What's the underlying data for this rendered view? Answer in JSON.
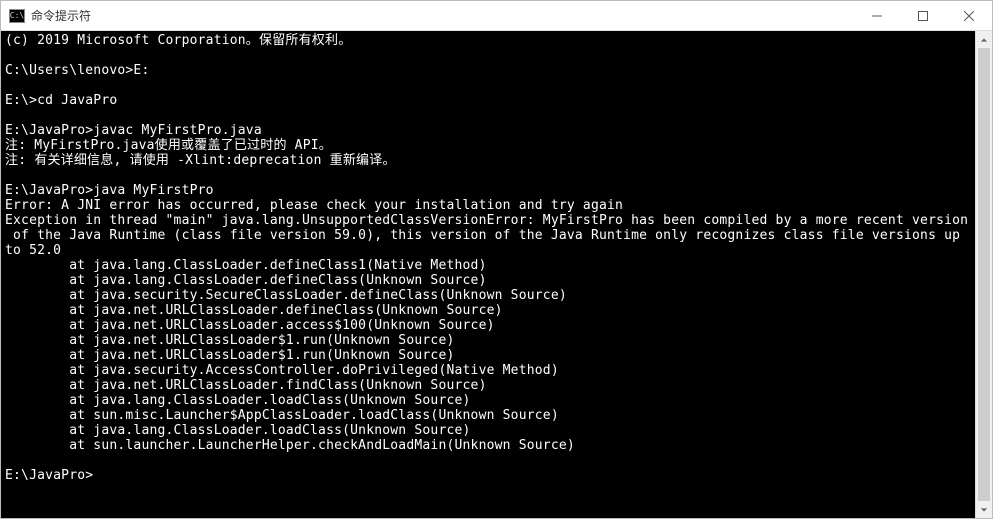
{
  "window": {
    "title": "命令提示符",
    "icon_text": "C:\\"
  },
  "terminal": {
    "lines": [
      "(c) 2019 Microsoft Corporation。保留所有权利。",
      "",
      "C:\\Users\\lenovo>E:",
      "",
      "E:\\>cd JavaPro",
      "",
      "E:\\JavaPro>javac MyFirstPro.java",
      "注: MyFirstPro.java使用或覆盖了已过时的 API。",
      "注: 有关详细信息, 请使用 -Xlint:deprecation 重新编译。",
      "",
      "E:\\JavaPro>java MyFirstPro",
      "Error: A JNI error has occurred, please check your installation and try again",
      "Exception in thread \"main\" java.lang.UnsupportedClassVersionError: MyFirstPro has been compiled by a more recent version",
      " of the Java Runtime (class file version 59.0), this version of the Java Runtime only recognizes class file versions up",
      "to 52.0",
      "        at java.lang.ClassLoader.defineClass1(Native Method)",
      "        at java.lang.ClassLoader.defineClass(Unknown Source)",
      "        at java.security.SecureClassLoader.defineClass(Unknown Source)",
      "        at java.net.URLClassLoader.defineClass(Unknown Source)",
      "        at java.net.URLClassLoader.access$100(Unknown Source)",
      "        at java.net.URLClassLoader$1.run(Unknown Source)",
      "        at java.net.URLClassLoader$1.run(Unknown Source)",
      "        at java.security.AccessController.doPrivileged(Native Method)",
      "        at java.net.URLClassLoader.findClass(Unknown Source)",
      "        at java.lang.ClassLoader.loadClass(Unknown Source)",
      "        at sun.misc.Launcher$AppClassLoader.loadClass(Unknown Source)",
      "        at java.lang.ClassLoader.loadClass(Unknown Source)",
      "        at sun.launcher.LauncherHelper.checkAndLoadMain(Unknown Source)",
      "",
      "E:\\JavaPro>"
    ]
  }
}
